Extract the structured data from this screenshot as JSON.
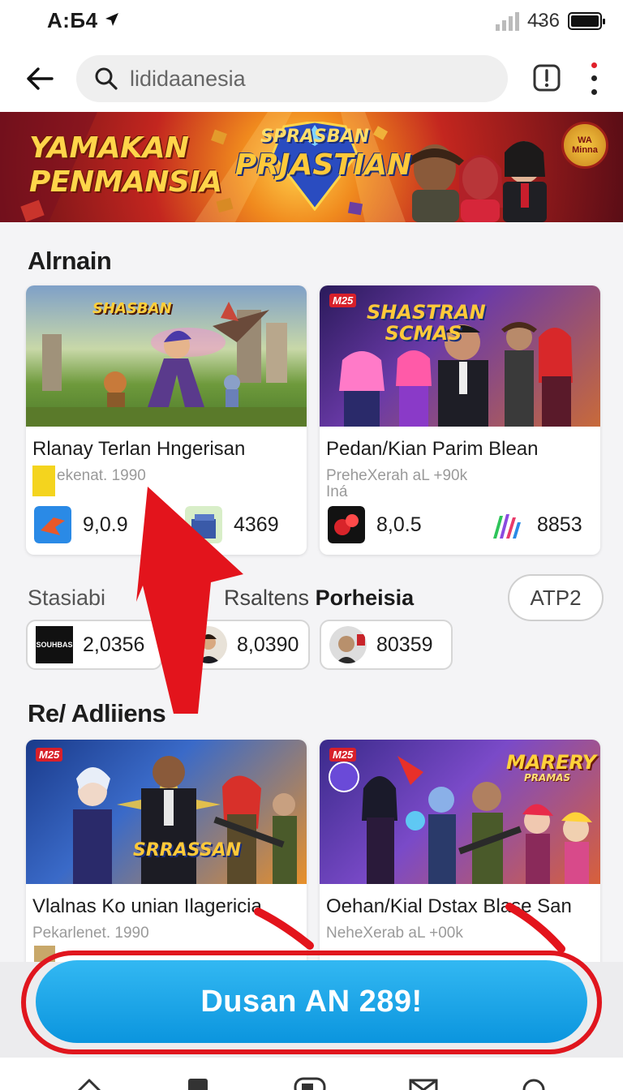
{
  "status_bar": {
    "time": "A:Б4",
    "signal_label": "4̶36"
  },
  "search": {
    "value": "lididaanesia"
  },
  "banner": {
    "left_line1": "YAMAKAN",
    "left_line2": "PENMANSIA",
    "logo_line1": "SPRASBAN",
    "logo_line2": "PRJASTIAN",
    "badge_text": "WA Minna"
  },
  "sections": {
    "first_title": "Alrnain",
    "second_title": "Re/ Adliiens"
  },
  "cards_top": [
    {
      "art_title": "SHASBAN",
      "title": "Rlanay Terlan Hngerisan",
      "meta": "ekenat. 1990",
      "stat1": "9,0.9",
      "stat2": "4369"
    },
    {
      "tag": "M25",
      "art_title": "SHASTRAN SCMAS",
      "title": "Pedan/Kian Parim Blean",
      "meta": "PreheXerah aL +90k",
      "meta2": "Iná",
      "stat1": "8,0.5",
      "stat2": "8853"
    }
  ],
  "chips_row": {
    "label_left": "Stasiabi",
    "label_mid_light": "Rsaltens ",
    "label_mid_bold": "Porheisia",
    "pill": "ATP2",
    "chips": [
      {
        "thumb_text": "SOUHBAS",
        "value": "2,0356"
      },
      {
        "value": "8,0390"
      },
      {
        "value": "80359"
      }
    ]
  },
  "cards_bottom": [
    {
      "tag": "M25",
      "art_title": "SRRASSAN",
      "title": "Vlalnas Ko unian Ilagericia",
      "meta": "Pekarlenet. 1990"
    },
    {
      "tag": "M25",
      "art_title": "MARERY",
      "art_sub": "PRAMAS",
      "title": "Oehan/Kial Dstax Blase San",
      "meta": "NeheXerab aL +00k"
    }
  ],
  "cta": {
    "label": "Dusan AN 289!"
  },
  "colors": {
    "cta": "#0b95de",
    "annotation": "#e0161e",
    "accent": "#d8202a"
  },
  "icons": [
    "back-arrow-icon",
    "search-icon",
    "info-icon",
    "more-vert-icon",
    "home-icon",
    "library-icon",
    "games-icon",
    "mail-icon",
    "search-nav-icon"
  ]
}
